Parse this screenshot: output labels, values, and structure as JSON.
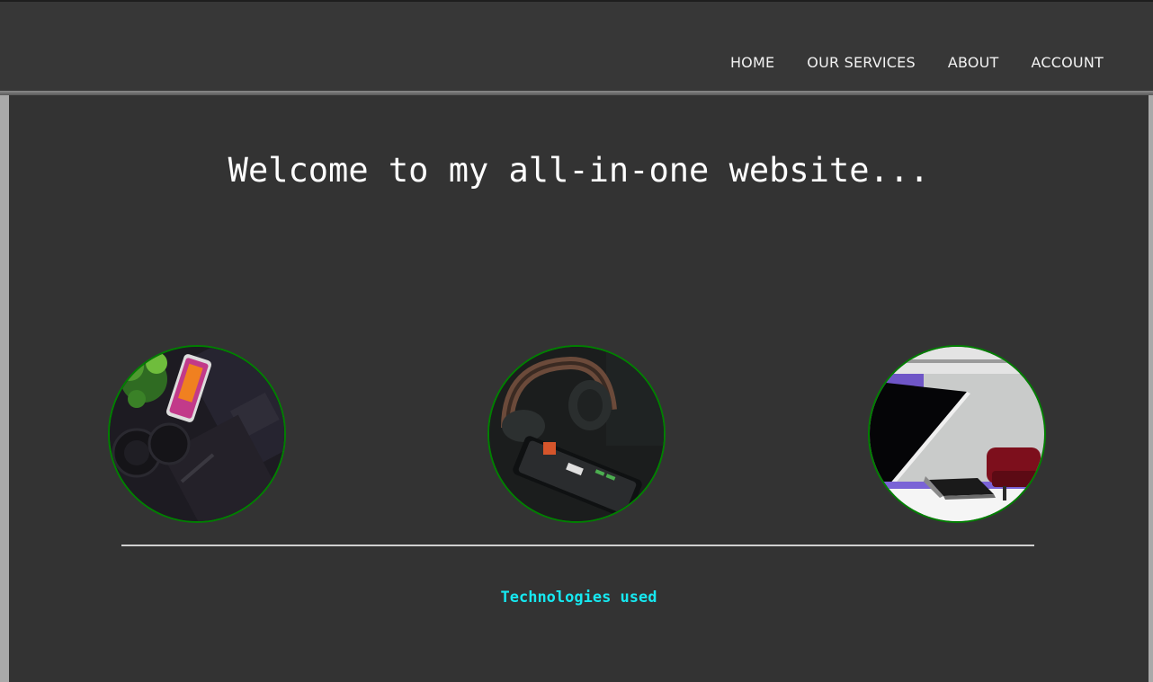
{
  "nav": {
    "items": [
      {
        "label": "HOME"
      },
      {
        "label": "OUR SERVICES"
      },
      {
        "label": "ABOUT"
      },
      {
        "label": "ACCOUNT"
      }
    ]
  },
  "main": {
    "heading": "Welcome to my all-in-one website...",
    "images": [
      {
        "icon": "desk-phone-photo"
      },
      {
        "icon": "headphones-phone-photo"
      },
      {
        "icon": "office-laptop-photo"
      }
    ],
    "section_title": "Technologies used"
  },
  "colors": {
    "navbar": "#373737",
    "background": "#333333",
    "circle_border": "#008000",
    "accent": "#16e8f0"
  }
}
